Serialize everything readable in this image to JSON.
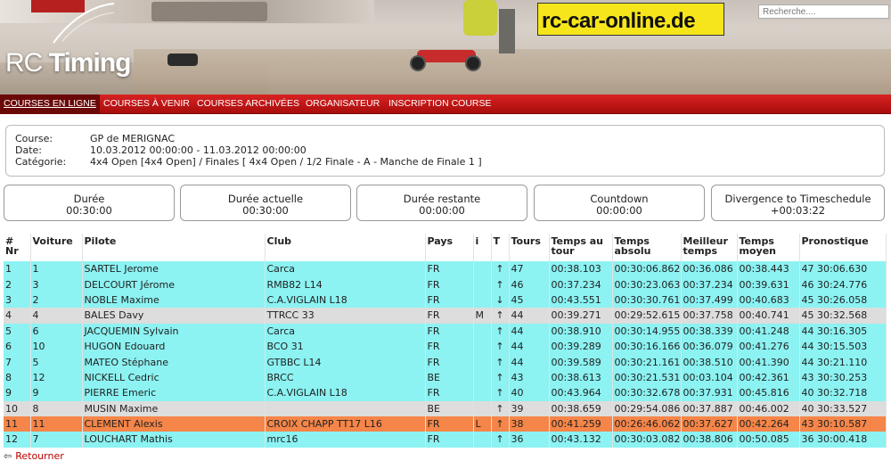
{
  "header": {
    "logo_text_light": "RC",
    "logo_text_bold": "Timing",
    "partner": "rc-car-online.de",
    "search_placeholder": "Recherche...."
  },
  "nav": [
    {
      "label": "COURSES EN LIGNE",
      "active": true
    },
    {
      "label": "COURSES À VENIR",
      "active": false
    },
    {
      "label": "COURSES ARCHIVÉES",
      "active": false
    },
    {
      "label": "ORGANISATEUR",
      "active": false
    },
    {
      "label": "INSCRIPTION COURSE",
      "active": false
    }
  ],
  "info": {
    "course_label": "Course:",
    "course": "GP de MERIGNAC",
    "date_label": "Date:",
    "date": "10.03.2012 00:00:00 - 11.03.2012 00:00:00",
    "category_label": "Catégorie:",
    "category": "4x4 Open [4x4 Open] / Finales [ 4x4 Open / 1/2 Finale - A - Manche de Finale 1 ]"
  },
  "timers": [
    {
      "label": "Durée",
      "value": "00:30:00"
    },
    {
      "label": "Durée actuelle",
      "value": "00:30:00"
    },
    {
      "label": "Durée restante",
      "value": "00:00:00"
    },
    {
      "label": "Countdown",
      "value": "00:00:00"
    },
    {
      "label": "Divergence to Timeschedule",
      "value": "+00:03:22"
    }
  ],
  "table": {
    "columns": [
      "# Nr",
      "Voiture",
      "Pilote",
      "Club",
      "Pays",
      "i",
      "T",
      "Tours",
      "Temps au tour",
      "Temps absolu",
      "Meilleur temps",
      "Temps moyen",
      "Pronostique"
    ],
    "rows": [
      {
        "pos": "1",
        "nr": "1",
        "pilot": "SARTEL Jerome",
        "club": "Carca",
        "country": "FR",
        "i": "",
        "trend": "up",
        "laps": "47",
        "lap": "00:38.103",
        "abs": "00:30:06.862",
        "best": "00:36.086",
        "avg": "00:38.443",
        "prog": "47 30:06.630",
        "color": "cyan"
      },
      {
        "pos": "2",
        "nr": "3",
        "pilot": "DELCOURT Jérome",
        "club": "RMB82 L14",
        "country": "FR",
        "i": "",
        "trend": "up",
        "laps": "46",
        "lap": "00:37.234",
        "abs": "00:30:23.063",
        "best": "00:37.234",
        "avg": "00:39.631",
        "prog": "46 30:24.776",
        "color": "cyan"
      },
      {
        "pos": "3",
        "nr": "2",
        "pilot": "NOBLE Maxime",
        "club": "C.A.VIGLAIN L18",
        "country": "FR",
        "i": "",
        "trend": "down",
        "laps": "45",
        "lap": "00:43.551",
        "abs": "00:30:30.761",
        "best": "00:37.499",
        "avg": "00:40.683",
        "prog": "45 30:26.058",
        "color": "cyan"
      },
      {
        "pos": "4",
        "nr": "4",
        "pilot": "BALES Davy",
        "club": "TTRCC 33",
        "country": "FR",
        "i": "M",
        "trend": "up",
        "laps": "44",
        "lap": "00:39.271",
        "abs": "00:29:52.615",
        "best": "00:37.758",
        "avg": "00:40.741",
        "prog": "45 30:32.568",
        "color": "grey"
      },
      {
        "pos": "5",
        "nr": "6",
        "pilot": "JACQUEMIN Sylvain",
        "club": "Carca",
        "country": "FR",
        "i": "",
        "trend": "up",
        "laps": "44",
        "lap": "00:38.910",
        "abs": "00:30:14.955",
        "best": "00:38.339",
        "avg": "00:41.248",
        "prog": "44 30:16.305",
        "color": "cyan"
      },
      {
        "pos": "6",
        "nr": "10",
        "pilot": "HUGON Edouard",
        "club": "BCO 31",
        "country": "FR",
        "i": "",
        "trend": "up",
        "laps": "44",
        "lap": "00:39.289",
        "abs": "00:30:16.166",
        "best": "00:36.079",
        "avg": "00:41.276",
        "prog": "44 30:15.503",
        "color": "cyan"
      },
      {
        "pos": "7",
        "nr": "5",
        "pilot": "MATEO Stéphane",
        "club": "GTBBC L14",
        "country": "FR",
        "i": "",
        "trend": "up",
        "laps": "44",
        "lap": "00:39.589",
        "abs": "00:30:21.161",
        "best": "00:38.510",
        "avg": "00:41.390",
        "prog": "44 30:21.110",
        "color": "cyan"
      },
      {
        "pos": "8",
        "nr": "12",
        "pilot": "NICKELL Cedric",
        "club": "BRCC",
        "country": "BE",
        "i": "",
        "trend": "up",
        "laps": "43",
        "lap": "00:38.613",
        "abs": "00:30:21.531",
        "best": "00:03.104",
        "avg": "00:42.361",
        "prog": "43 30:30.253",
        "color": "cyan"
      },
      {
        "pos": "9",
        "nr": "9",
        "pilot": "PIERRE Emeric",
        "club": "C.A.VIGLAIN L18",
        "country": "FR",
        "i": "",
        "trend": "up",
        "laps": "40",
        "lap": "00:43.964",
        "abs": "00:30:32.678",
        "best": "00:37.931",
        "avg": "00:45.816",
        "prog": "40 30:32.718",
        "color": "cyan"
      },
      {
        "pos": "10",
        "nr": "8",
        "pilot": "MUSIN Maxime",
        "club": "",
        "country": "BE",
        "i": "",
        "trend": "up",
        "laps": "39",
        "lap": "00:38.659",
        "abs": "00:29:54.086",
        "best": "00:37.887",
        "avg": "00:46.002",
        "prog": "40 30:33.527",
        "color": "grey"
      },
      {
        "pos": "11",
        "nr": "11",
        "pilot": "CLEMENT Alexis",
        "club": "CROIX CHAPP TT17 L16",
        "country": "FR",
        "i": "L",
        "trend": "up",
        "laps": "38",
        "lap": "00:41.259",
        "abs": "00:26:46.062",
        "best": "00:37.627",
        "avg": "00:42.264",
        "prog": "43 30:10.587",
        "color": "orange"
      },
      {
        "pos": "12",
        "nr": "7",
        "pilot": "LOUCHART Mathis",
        "club": "mrc16",
        "country": "FR",
        "i": "",
        "trend": "up",
        "laps": "36",
        "lap": "00:43.132",
        "abs": "00:30:03.082",
        "best": "00:38.806",
        "avg": "00:50.085",
        "prog": "36 30:00.418",
        "color": "cyan"
      }
    ]
  },
  "back_label": "Retourner",
  "icons": {
    "back": "arrow-left-icon",
    "trend_up": "arrow-up-icon",
    "trend_down": "arrow-down-icon"
  }
}
